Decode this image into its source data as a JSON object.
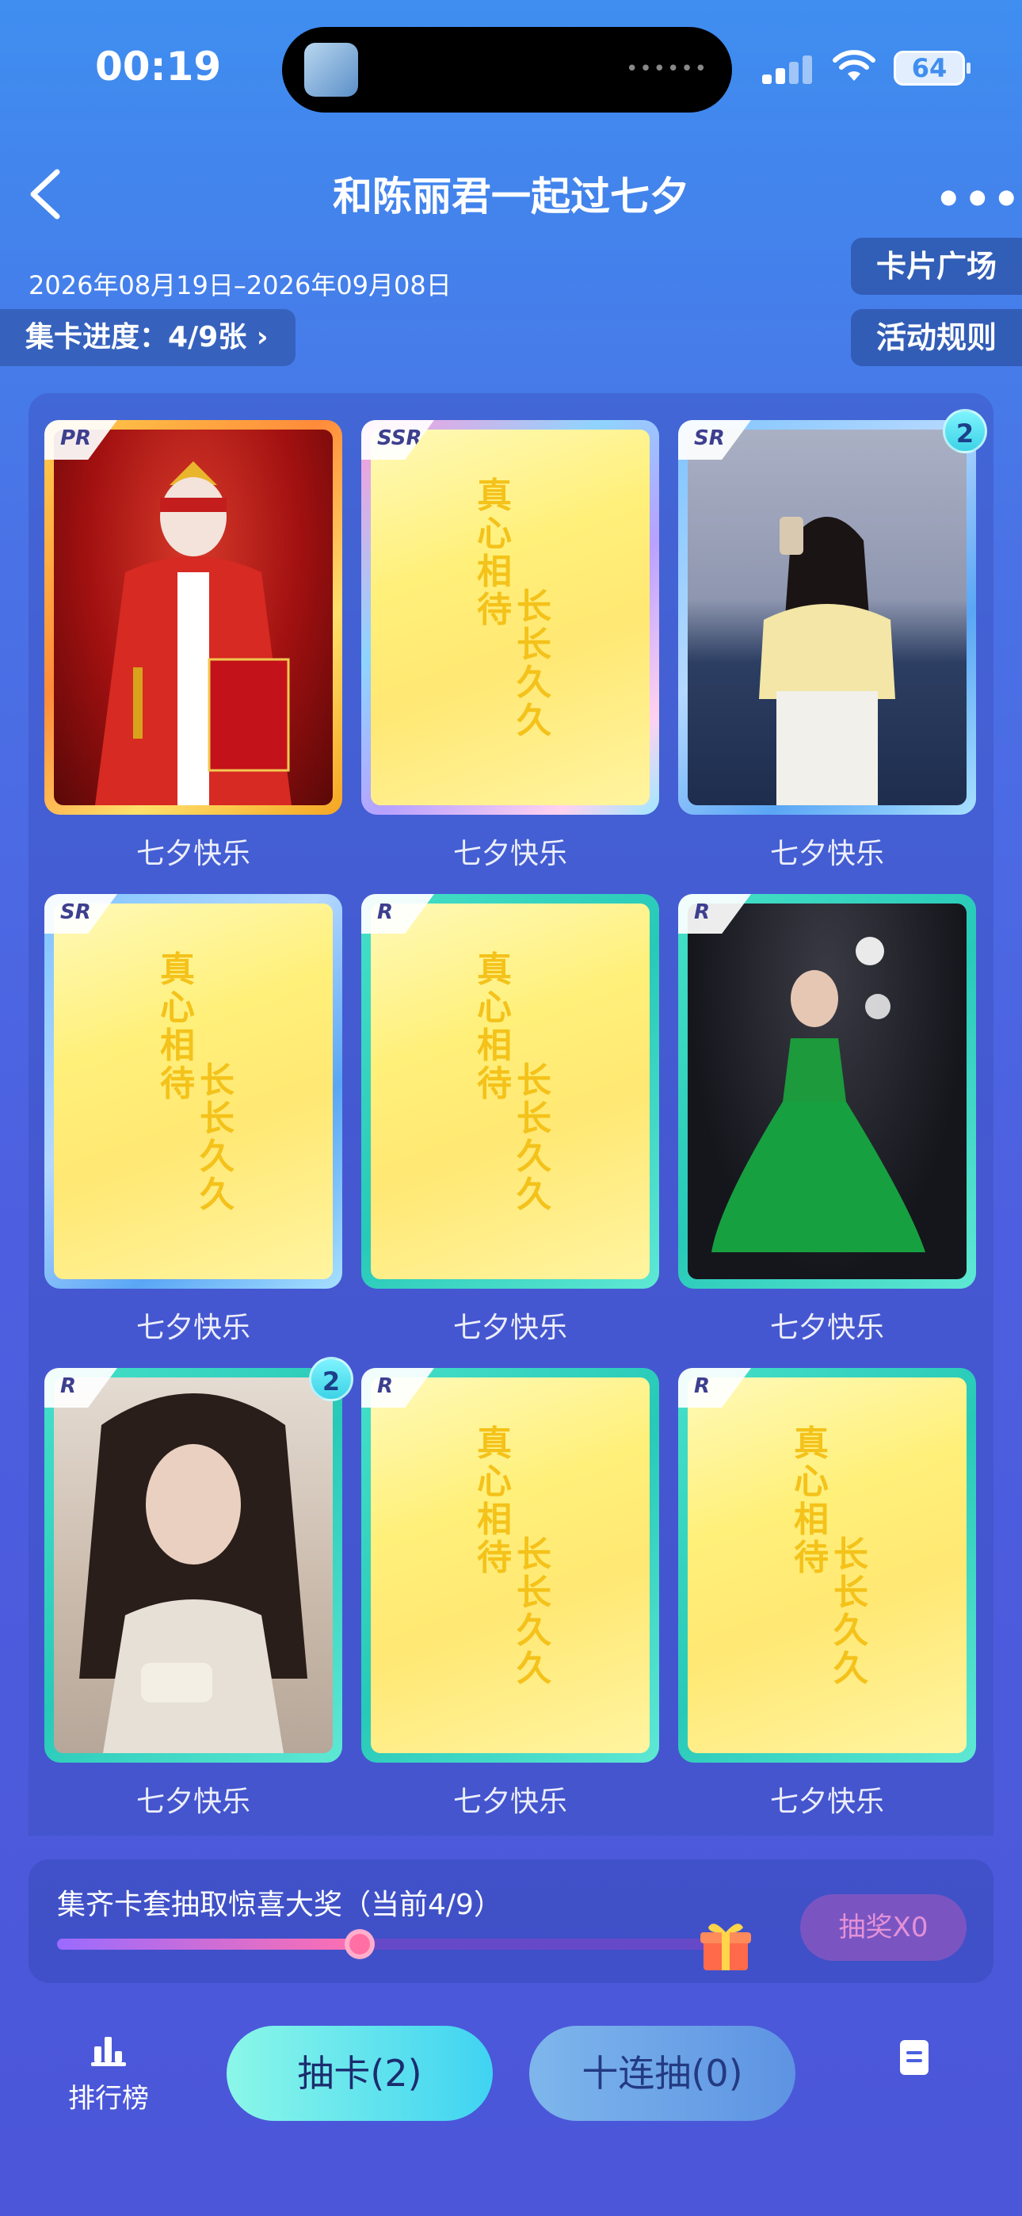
{
  "status_bar": {
    "time": "00:19",
    "battery": "64"
  },
  "header": {
    "title": "和陈丽君一起过七夕"
  },
  "event": {
    "date_range": "2026年08月19日–2026年09月08日",
    "progress_label": "集卡进度：4/9张",
    "card_plaza": "卡片广场",
    "rules": "活动规则"
  },
  "cards": [
    {
      "rarity": "PR",
      "label": "七夕快乐",
      "owned": true,
      "count": "",
      "photo": "opera-costume-photo"
    },
    {
      "rarity": "SSR",
      "label": "七夕快乐",
      "owned": false,
      "count": ""
    },
    {
      "rarity": "SR",
      "label": "七夕快乐",
      "owned": true,
      "count": "2",
      "photo": "seaside-selfie-photo"
    },
    {
      "rarity": "SR",
      "label": "七夕快乐",
      "owned": false,
      "count": ""
    },
    {
      "rarity": "R",
      "label": "七夕快乐",
      "owned": false,
      "count": ""
    },
    {
      "rarity": "R",
      "label": "七夕快乐",
      "owned": true,
      "count": "",
      "photo": "green-gown-photo"
    },
    {
      "rarity": "R",
      "label": "七夕快乐",
      "owned": true,
      "count": "2",
      "photo": "portrait-photo"
    },
    {
      "rarity": "R",
      "label": "七夕快乐",
      "owned": false,
      "count": ""
    },
    {
      "rarity": "R",
      "label": "七夕快乐",
      "owned": false,
      "count": ""
    }
  ],
  "card_back": {
    "line1": "真心相待",
    "line2": "长长久久"
  },
  "reward": {
    "text": "集齐卡套抽取惊喜大奖（当前4/9）",
    "progress_fraction": 0.444,
    "draw_label": "抽奖X0"
  },
  "bottom": {
    "rank_label": "排行榜",
    "draw_label": "抽卡(2)",
    "ten_draw_label": "十连抽(0)"
  },
  "colors": {
    "accent_teal": "#3fd3f2",
    "frame_pr": "#ffb03a",
    "frame_r": "#28c9b8",
    "card_back_yellow": "#fff07a"
  }
}
